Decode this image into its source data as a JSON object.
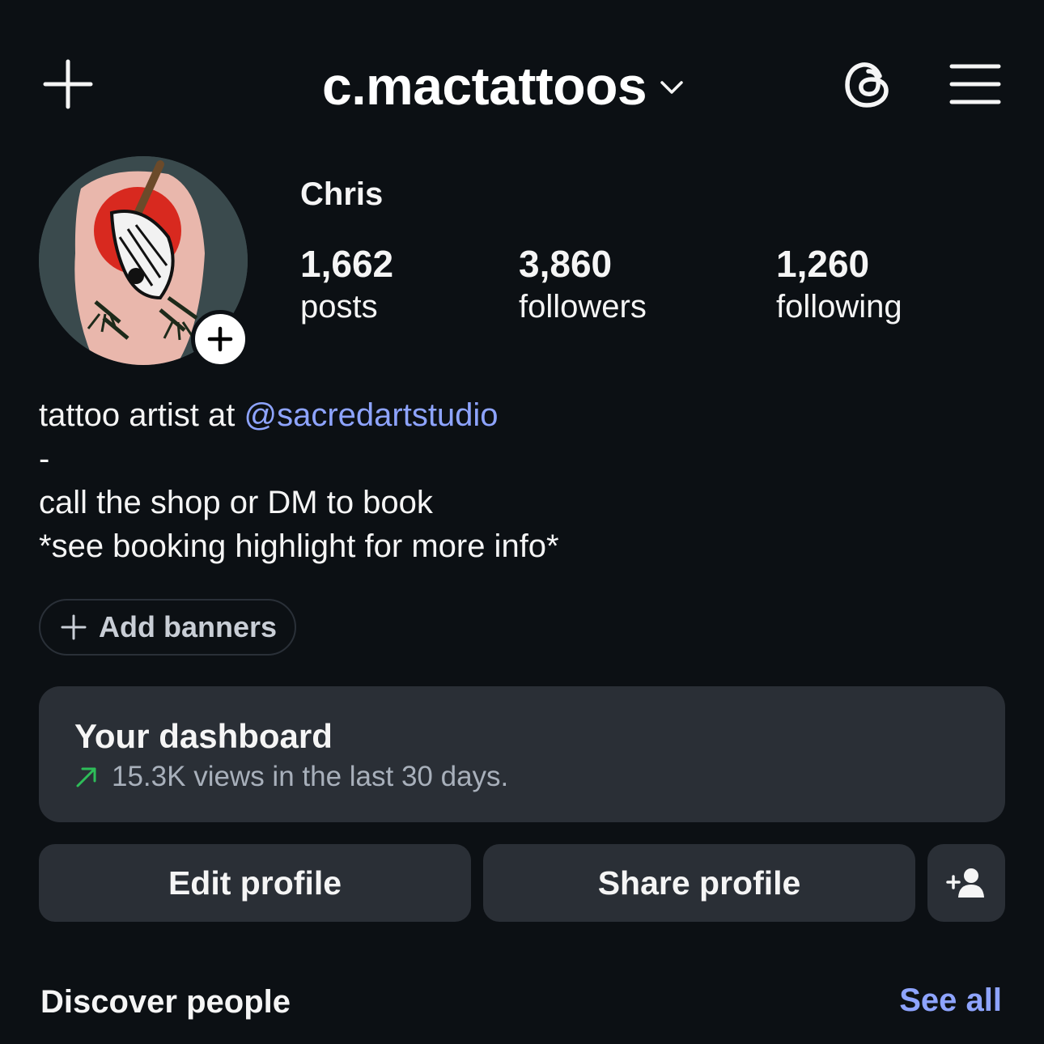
{
  "header": {
    "username": "c.mactattoos",
    "icons": {
      "create": "plus-icon",
      "account_switch": "chevron-down-icon",
      "threads": "threads-icon",
      "menu": "hamburger-menu-icon"
    }
  },
  "profile": {
    "display_name": "Chris",
    "stats": [
      {
        "value": "1,662",
        "label": "posts"
      },
      {
        "value": "3,860",
        "label": "followers"
      },
      {
        "value": "1,260",
        "label": "following"
      }
    ]
  },
  "bio": {
    "line1_prefix": "tattoo artist at ",
    "line1_mention": "@sacredartstudio",
    "line2": "-",
    "line3": "call the shop or DM to book",
    "line4": "*see booking highlight for more info*"
  },
  "banners": {
    "label": "Add banners"
  },
  "dashboard": {
    "title": "Your dashboard",
    "subtitle": "15.3K views in the last 30 days.",
    "trend_color": "#2ebd59"
  },
  "actions": {
    "edit": "Edit profile",
    "share": "Share profile",
    "add_person_icon": "add-person-icon"
  },
  "discover": {
    "title": "Discover people",
    "see_all": "See all"
  },
  "colors": {
    "background": "#0c1014",
    "card": "#2a2f36",
    "link": "#8ea4ff",
    "text": "#f5f5f5"
  }
}
